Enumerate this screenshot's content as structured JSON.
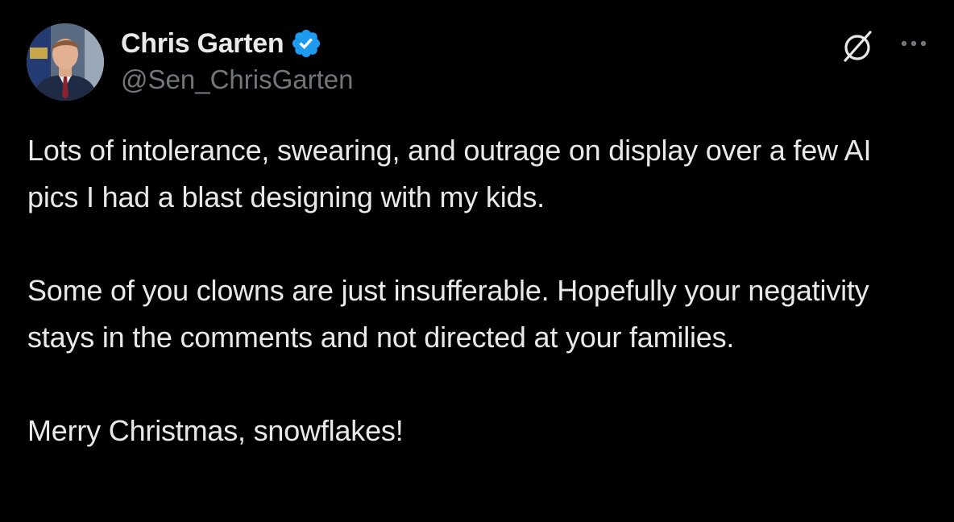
{
  "author": {
    "display_name": "Chris Garten",
    "handle": "@Sen_ChrisGarten",
    "verified": true,
    "verified_icon": "verified-badge-icon",
    "avatar_icon": "profile-avatar"
  },
  "actions": {
    "grok_icon": "grok-slash-circle-icon",
    "more_icon": "more-options-icon"
  },
  "tweet": {
    "paragraphs": [
      "Lots of intolerance, swearing, and outrage on display over a few AI pics I had a blast designing with my kids.",
      "Some of you clowns are just insufferable. Hopefully your negativity stays in the comments and not directed at your families.",
      "Merry Christmas, snowflakes!"
    ]
  },
  "colors": {
    "background": "#000000",
    "primary_text": "#e7e9ea",
    "secondary_text": "#71767b",
    "verified_blue": "#1d9bf0"
  }
}
